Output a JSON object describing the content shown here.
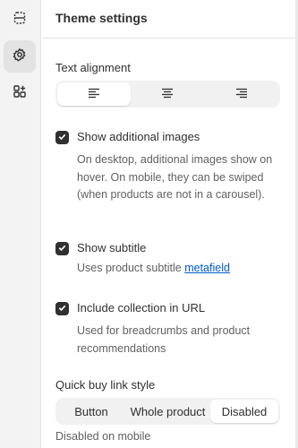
{
  "rail": {
    "items": [
      {
        "icon": "sections-icon",
        "active": false
      },
      {
        "icon": "gear-icon",
        "active": true
      },
      {
        "icon": "apps-add-icon",
        "active": false
      }
    ]
  },
  "panel": {
    "title": "Theme settings"
  },
  "text_alignment": {
    "label": "Text alignment",
    "options": [
      {
        "icon": "align-left-icon",
        "selected": true
      },
      {
        "icon": "align-center-icon",
        "selected": false
      },
      {
        "icon": "align-right-icon",
        "selected": false
      }
    ]
  },
  "checkboxes": {
    "additional_images": {
      "label": "Show additional images",
      "checked": true,
      "help": "On desktop, additional images show on hover. On mobile, they can be swiped (when products are not in a carousel)."
    },
    "subtitle": {
      "label": "Show subtitle",
      "checked": true,
      "help_prefix": "Uses product subtitle ",
      "help_link": "metafield"
    },
    "collection_url": {
      "label": "Include collection in URL",
      "checked": true,
      "help": "Used for breadcrumbs and product recommendations"
    }
  },
  "quick_buy": {
    "label": "Quick buy link style",
    "options": [
      "Button",
      "Whole product",
      "Disabled"
    ],
    "selected": "Disabled",
    "help": "Disabled on mobile"
  },
  "colors": {
    "accent_dark": "#303030",
    "link": "#005bd3",
    "rail_bg": "#f3f3f3",
    "segmented_bg": "#f1f1f1",
    "muted_text": "#616161"
  }
}
